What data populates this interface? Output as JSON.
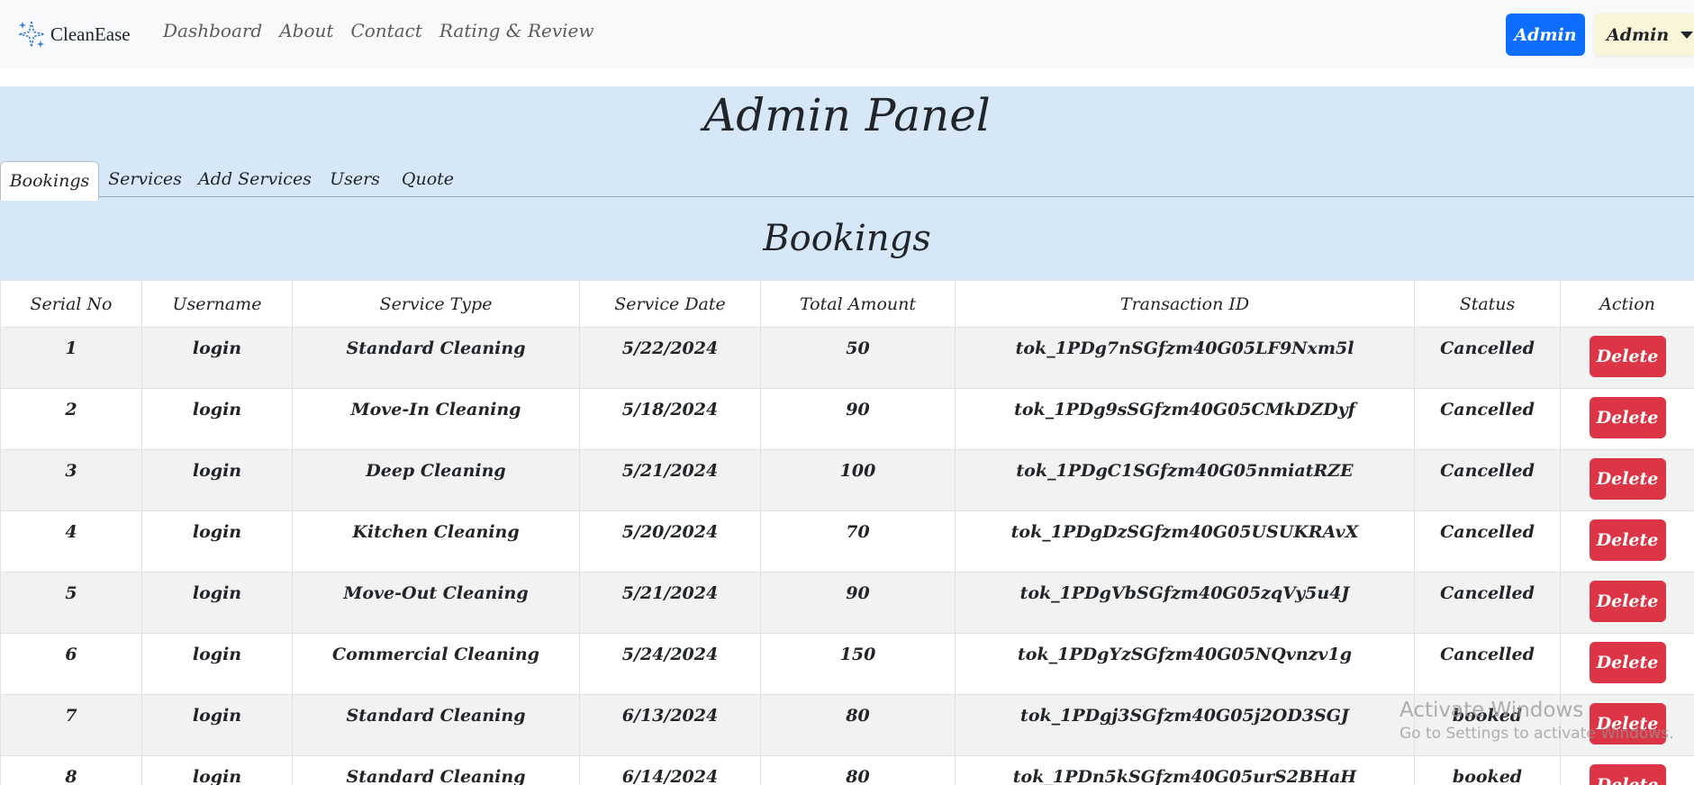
{
  "navbar": {
    "brand": "CleanEase",
    "links": [
      "Dashboard",
      "About",
      "Contact",
      "Rating & Review"
    ],
    "admin_button": "Admin",
    "dropdown_label": "Admin"
  },
  "panel": {
    "title": "Admin Panel",
    "tabs": [
      "Bookings",
      "Services",
      "Add Services",
      "Users",
      "Quote"
    ],
    "active_tab": "Bookings",
    "section_title": "Bookings"
  },
  "table": {
    "headers": [
      "Serial No",
      "Username",
      "Service Type",
      "Service Date",
      "Total Amount",
      "Transaction ID",
      "Status",
      "Action"
    ],
    "delete_label": "Delete",
    "rows": [
      {
        "serial": "1",
        "username": "login",
        "service": "Standard Cleaning",
        "date": "5/22/2024",
        "amount": "50",
        "txn": "tok_1PDg7nSGfzm40G05LF9Nxm5l",
        "status": "Cancelled"
      },
      {
        "serial": "2",
        "username": "login",
        "service": "Move-In Cleaning",
        "date": "5/18/2024",
        "amount": "90",
        "txn": "tok_1PDg9sSGfzm40G05CMkDZDyf",
        "status": "Cancelled"
      },
      {
        "serial": "3",
        "username": "login",
        "service": "Deep Cleaning",
        "date": "5/21/2024",
        "amount": "100",
        "txn": "tok_1PDgC1SGfzm40G05nmiatRZE",
        "status": "Cancelled"
      },
      {
        "serial": "4",
        "username": "login",
        "service": "Kitchen Cleaning",
        "date": "5/20/2024",
        "amount": "70",
        "txn": "tok_1PDgDzSGfzm40G05USUKRAvX",
        "status": "Cancelled"
      },
      {
        "serial": "5",
        "username": "login",
        "service": "Move-Out Cleaning",
        "date": "5/21/2024",
        "amount": "90",
        "txn": "tok_1PDgVbSGfzm40G05zqVy5u4J",
        "status": "Cancelled"
      },
      {
        "serial": "6",
        "username": "login",
        "service": "Commercial Cleaning",
        "date": "5/24/2024",
        "amount": "150",
        "txn": "tok_1PDgYzSGfzm40G05NQvnzv1g",
        "status": "Cancelled"
      },
      {
        "serial": "7",
        "username": "login",
        "service": "Standard Cleaning",
        "date": "6/13/2024",
        "amount": "80",
        "txn": "tok_1PDgj3SGfzm40G05j2OD3SGJ",
        "status": "booked"
      },
      {
        "serial": "8",
        "username": "login",
        "service": "Standard Cleaning",
        "date": "6/14/2024",
        "amount": "80",
        "txn": "tok_1PDn5kSGfzm40G05urS2BHaH",
        "status": "booked"
      }
    ]
  },
  "watermark": {
    "line1": "Activate Windows",
    "line2": "Go to Settings to activate Windows."
  },
  "colors": {
    "primary": "#0d6efd",
    "danger": "#dc3545",
    "panel_bg": "#d6e8f7",
    "navbar_bg": "#f8f9fa",
    "dropdown_bg": "#f8f5d9"
  },
  "icons": {
    "brand": "sparkles-icon",
    "dropdown": "caret-down-icon"
  }
}
